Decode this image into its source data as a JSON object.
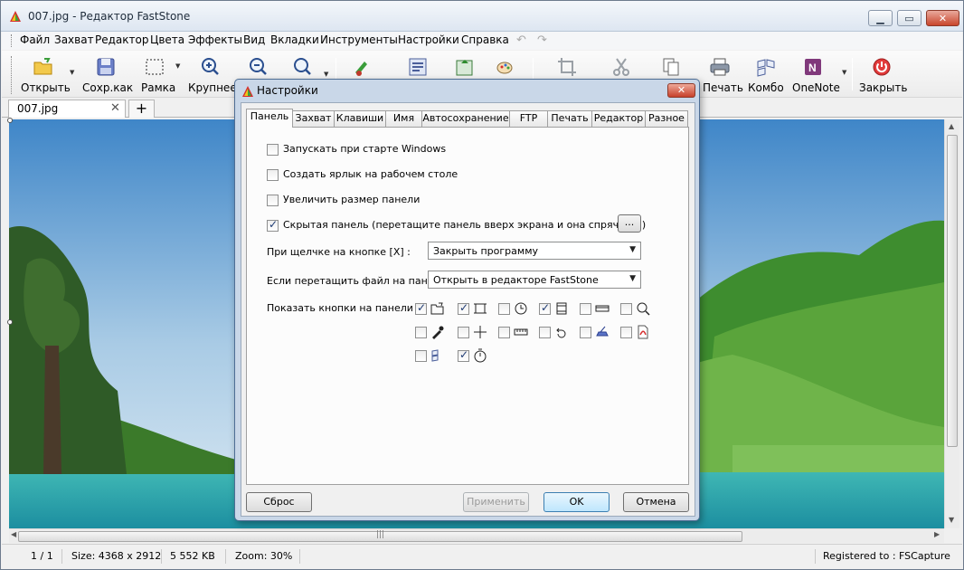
{
  "window": {
    "title": "007.jpg - Редактор FastStone",
    "min_glyph": "▁",
    "max_glyph": "▭",
    "close_glyph": "✕"
  },
  "menu": [
    "Файл",
    "Захват",
    "Редактор",
    "Цвета",
    "Эффекты",
    "Вид",
    "Вкладки",
    "Инструменты",
    "Настройки",
    "Справка"
  ],
  "toolbar": {
    "open": "Открыть",
    "save_as": "Сохр.как",
    "frame": "Рамка",
    "zoom_in": "Крупнее",
    "print": "Печать",
    "combo": "Комбо",
    "onenote": "OneNote",
    "close": "Закрыть"
  },
  "tabs": {
    "doc_name": "007.jpg",
    "close_glyph": "✕",
    "plus_glyph": "+"
  },
  "status": {
    "page": "1 / 1",
    "size": "Size: 4368 x 2912",
    "kb": "5 552 KB",
    "zoom": "Zoom: 30%",
    "registered": "Registered to : FSCapture"
  },
  "dialog": {
    "title": "Настройки",
    "close_glyph": "✕",
    "tabs": [
      "Панель",
      "Захват",
      "Клавиши",
      "Имя",
      "Автосохранение",
      "FTP",
      "Печать",
      "Редактор",
      "Разное"
    ],
    "options": {
      "run_at_start": {
        "label": "Запускать при старте Windows",
        "checked": false
      },
      "desktop_shortcut": {
        "label": "Создать ярлык на рабочем столе",
        "checked": false
      },
      "enlarge_panel": {
        "label": "Увеличить размер панели",
        "checked": false
      },
      "hidden_panel": {
        "label": "Скрытая панель (перетащите панель вверх экрана и она спрячется)",
        "checked": true
      }
    },
    "ellipsis_button": "...",
    "close_click_label": "При щелчке на кнопке [X] :",
    "close_click_value": "Закрыть программу",
    "drag_file_label": "Если перетащить файл на панель",
    "drag_file_value": "Открыть в редакторе FastStone",
    "show_buttons_label": "Показать кнопки на панели :",
    "panel_buttons": [
      {
        "icon": "open-folder-icon",
        "checked": true
      },
      {
        "icon": "rectangle-region-icon",
        "checked": true
      },
      {
        "icon": "clock-icon",
        "checked": false
      },
      {
        "icon": "film-icon",
        "checked": true
      },
      {
        "icon": "scrolling-window-icon",
        "checked": false
      },
      {
        "icon": "magnifier-icon",
        "checked": false
      },
      {
        "icon": "color-picker-icon",
        "checked": false
      },
      {
        "icon": "crosshair-icon",
        "checked": false
      },
      {
        "icon": "ruler-icon",
        "checked": false
      },
      {
        "icon": "undo-arrow-icon",
        "checked": false
      },
      {
        "icon": "scanner-icon",
        "checked": false
      },
      {
        "icon": "pdf-icon",
        "checked": false
      },
      {
        "icon": "combine-icon",
        "checked": false
      },
      {
        "icon": "timer-icon",
        "checked": true
      }
    ],
    "buttons": {
      "reset": "Сброс",
      "apply": "Применить",
      "ok": "OK",
      "cancel": "Отмена"
    }
  }
}
